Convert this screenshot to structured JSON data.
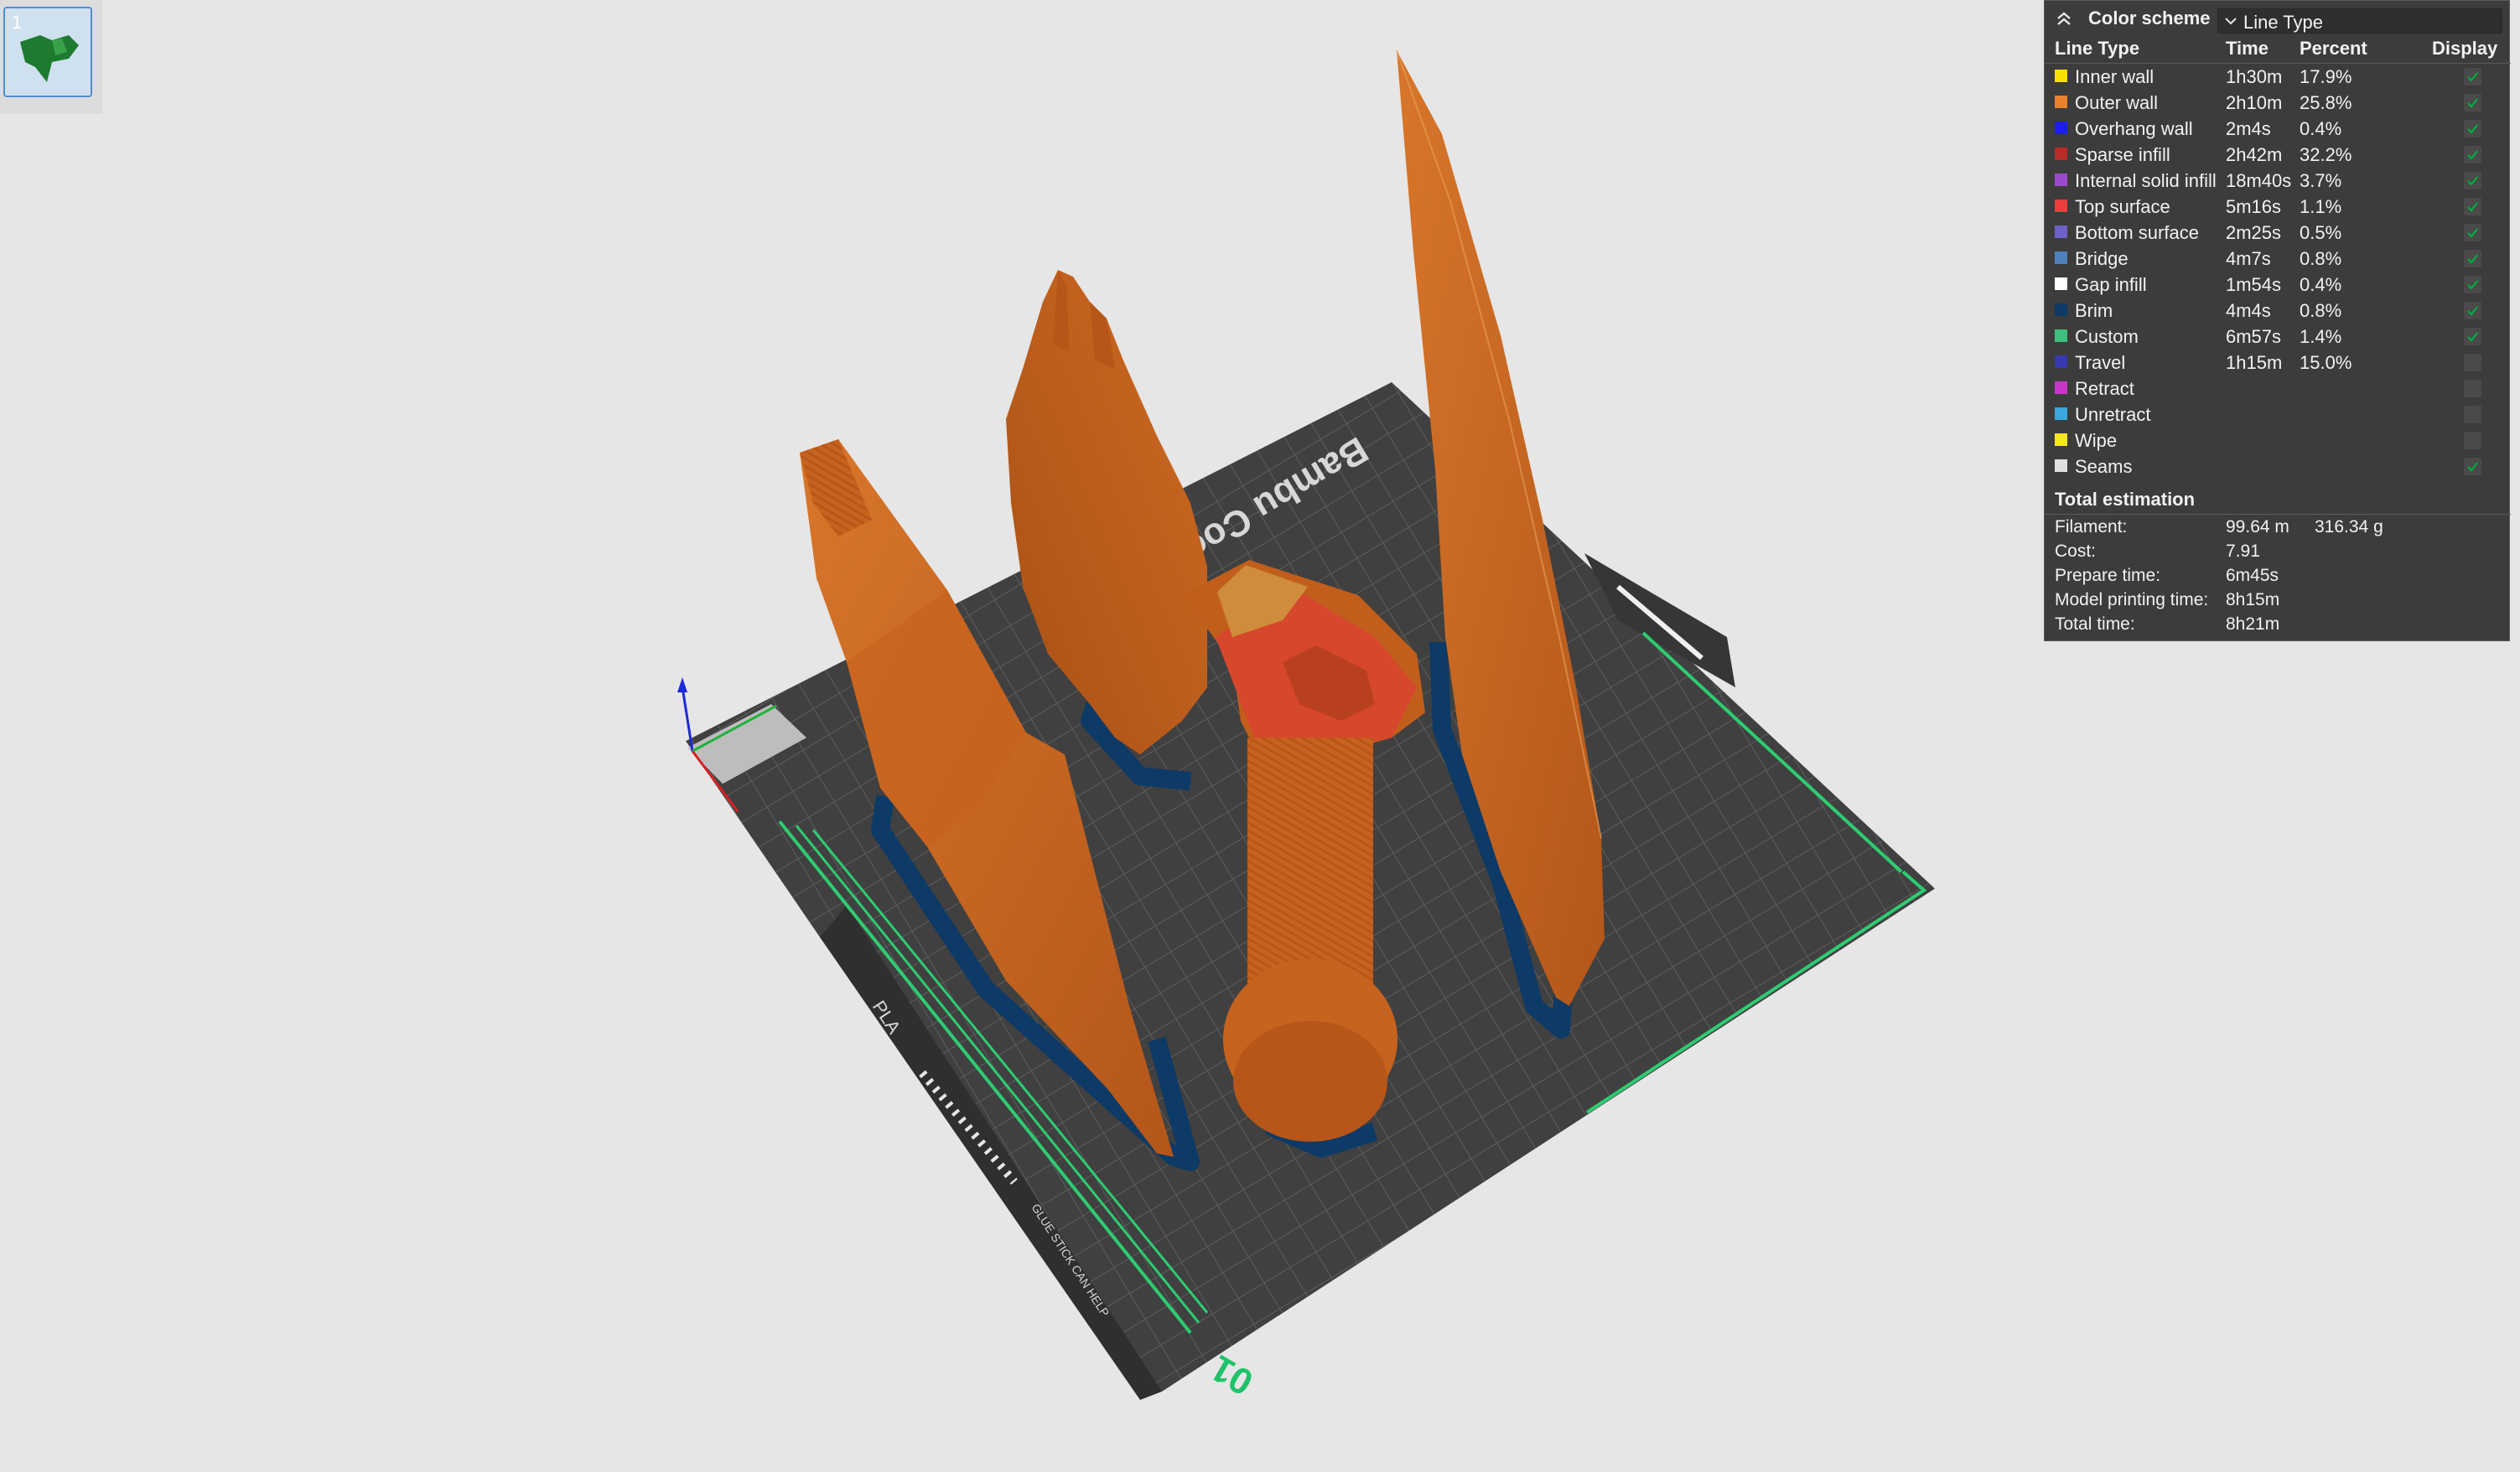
{
  "plate": {
    "number": "1"
  },
  "legend": {
    "color_scheme_label": "Color scheme",
    "color_scheme_value": "Line Type",
    "headers": {
      "line_type": "Line Type",
      "time": "Time",
      "percent": "Percent",
      "display": "Display"
    },
    "rows": [
      {
        "label": "Inner wall",
        "time": "1h30m",
        "percent": "17.9%",
        "color": "#f5e000",
        "checked": true
      },
      {
        "label": "Outer wall",
        "time": "2h10m",
        "percent": "25.8%",
        "color": "#e8832a",
        "checked": true
      },
      {
        "label": "Overhang wall",
        "time": "2m4s",
        "percent": "0.4%",
        "color": "#1d1ee8",
        "checked": true
      },
      {
        "label": "Sparse infill",
        "time": "2h42m",
        "percent": "32.2%",
        "color": "#b92b27",
        "checked": true
      },
      {
        "label": "Internal solid infill",
        "time": "18m40s",
        "percent": "3.7%",
        "color": "#9b4bc9",
        "checked": true
      },
      {
        "label": "Top surface",
        "time": "5m16s",
        "percent": "1.1%",
        "color": "#ee3b3b",
        "checked": true
      },
      {
        "label": "Bottom surface",
        "time": "2m25s",
        "percent": "0.5%",
        "color": "#6d61c9",
        "checked": true
      },
      {
        "label": "Bridge",
        "time": "4m7s",
        "percent": "0.8%",
        "color": "#4f81bd",
        "checked": true
      },
      {
        "label": "Gap infill",
        "time": "1m54s",
        "percent": "0.4%",
        "color": "#ffffff",
        "checked": true
      },
      {
        "label": "Brim",
        "time": "4m4s",
        "percent": "0.8%",
        "color": "#0d3a66",
        "checked": true
      },
      {
        "label": "Custom",
        "time": "6m57s",
        "percent": "1.4%",
        "color": "#3fbf7f",
        "checked": true
      },
      {
        "label": "Travel",
        "time": "1h15m",
        "percent": "15.0%",
        "color": "#3838b0",
        "checked": false
      },
      {
        "label": "Retract",
        "time": "",
        "percent": "",
        "color": "#c837c8",
        "checked": false
      },
      {
        "label": "Unretract",
        "time": "",
        "percent": "",
        "color": "#3aa7de",
        "checked": false
      },
      {
        "label": "Wipe",
        "time": "",
        "percent": "",
        "color": "#f5e61e",
        "checked": false
      },
      {
        "label": "Seams",
        "time": "",
        "percent": "",
        "color": "#e0e0e0",
        "checked": true
      }
    ],
    "total": {
      "title": "Total estimation",
      "filament_label": "Filament:",
      "filament_length": "99.64 m",
      "filament_weight": "316.34 g",
      "cost_label": "Cost:",
      "cost": "7.91",
      "prepare_label": "Prepare time:",
      "prepare": "6m45s",
      "model_label": "Model printing time:",
      "model": "8h15m",
      "total_label": "Total time:",
      "total": "8h21m"
    }
  },
  "plate_text": {
    "brand": "Bambu Cool",
    "material": "PLA",
    "plate_no": "01",
    "notice": "GLUE STICK CAN HELP"
  },
  "colors": {
    "accent": "#00ae42",
    "model": "#c8641e",
    "plate": "#4a4a4a",
    "brim": "#0d3a66"
  }
}
